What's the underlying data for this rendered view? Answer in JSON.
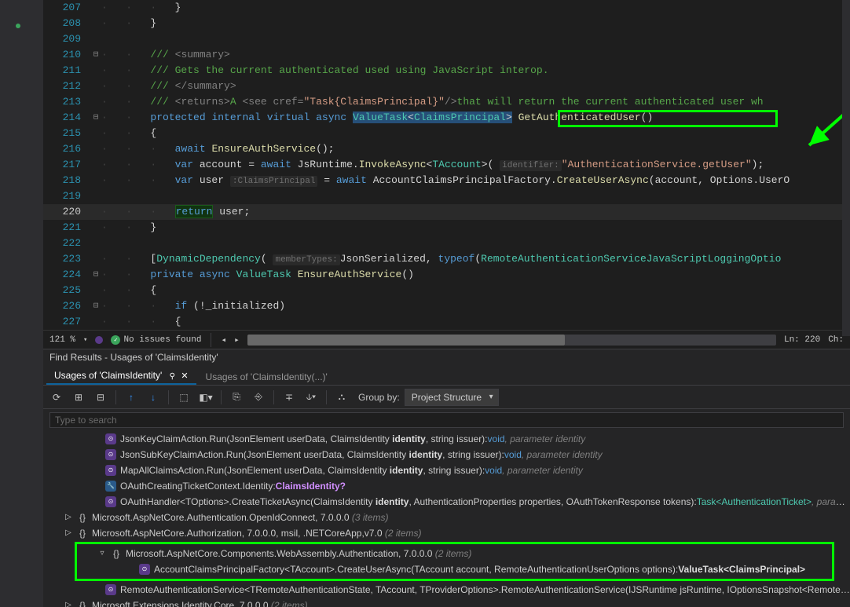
{
  "editor": {
    "zoom": "121 %",
    "no_issues": "No issues found",
    "line_pos": "Ln: 220",
    "char_pos": "Ch:",
    "lines": [
      {
        "n": "207",
        "fold": "",
        "code": "            }"
      },
      {
        "n": "208",
        "fold": "",
        "code": "        }"
      },
      {
        "n": "209",
        "fold": "",
        "code": ""
      },
      {
        "n": "210",
        "fold": "⊟",
        "code": "        /// <summary>"
      },
      {
        "n": "211",
        "fold": "",
        "code": "        /// Gets the current authenticated used using JavaScript interop."
      },
      {
        "n": "212",
        "fold": "",
        "code": "        /// </summary>"
      },
      {
        "n": "213",
        "fold": "",
        "code": "        /// <returns>A <see cref=\"Task{ClaimsPrincipal}\"/>that will return the current authenticated user wh"
      },
      {
        "n": "214",
        "fold": "⊟",
        "code": "        protected internal virtual async ValueTask<ClaimsPrincipal> GetAuthenticatedUser()"
      },
      {
        "n": "215",
        "fold": "",
        "code": "        {"
      },
      {
        "n": "216",
        "fold": "",
        "code": "            await EnsureAuthService();"
      },
      {
        "n": "217",
        "fold": "",
        "code": "            var account = await JsRuntime.InvokeAsync<TAccount>( identifier:\"AuthenticationService.getUser\");"
      },
      {
        "n": "218",
        "fold": "",
        "code": "            var user :ClaimsPrincipal = await AccountClaimsPrincipalFactory.CreateUserAsync(account, Options.UserO"
      },
      {
        "n": "219",
        "fold": "",
        "code": ""
      },
      {
        "n": "220",
        "fold": "",
        "code": "            return user;"
      },
      {
        "n": "221",
        "fold": "",
        "code": "        }"
      },
      {
        "n": "222",
        "fold": "",
        "code": ""
      },
      {
        "n": "223",
        "fold": "",
        "code": "        [DynamicDependency( memberTypes:JsonSerialized, typeof(RemoteAuthenticationServiceJavaScriptLoggingOptio"
      },
      {
        "n": "224",
        "fold": "⊟",
        "code": "        private async ValueTask EnsureAuthService()"
      },
      {
        "n": "225",
        "fold": "",
        "code": "        {"
      },
      {
        "n": "226",
        "fold": "⊟",
        "code": "            if (!_initialized)"
      },
      {
        "n": "227",
        "fold": "",
        "code": "            {"
      }
    ],
    "current_line": "220"
  },
  "find": {
    "title": "Find Results - Usages of 'ClaimsIdentity'",
    "tab1": "Usages of 'ClaimsIdentity'",
    "tab2": "Usages of 'ClaimsIdentity(...)'",
    "groupby_label": "Group by:",
    "groupby_value": "Project Structure",
    "search_placeholder": "Type to search",
    "rows": [
      {
        "indent": 3,
        "arrow": "",
        "icon": "method",
        "pre": "JsonKeyClaimAction.Run(JsonElement userData, ClaimsIdentity ",
        "b": "identity",
        "post": ", string issuer):",
        "rtype": "void",
        "tail": ", parameter identity"
      },
      {
        "indent": 3,
        "arrow": "",
        "icon": "method",
        "pre": "JsonSubKeyClaimAction.Run(JsonElement userData, ClaimsIdentity ",
        "b": "identity",
        "post": ", string issuer):",
        "rtype": "void",
        "tail": ", parameter identity"
      },
      {
        "indent": 3,
        "arrow": "",
        "icon": "method",
        "pre": "MapAllClaimsAction.Run(JsonElement userData, ClaimsIdentity ",
        "b": "identity",
        "post": ", string issuer):",
        "rtype": "void",
        "tail": ", parameter identity"
      },
      {
        "indent": 3,
        "arrow": "",
        "icon": "prop",
        "pre": "OAuthCreatingTicketContext.Identity:",
        "b": "",
        "post": "",
        "rtype": "",
        "tail": "",
        "typeq": "ClaimsIdentity?"
      },
      {
        "indent": 3,
        "arrow": "",
        "icon": "method",
        "pre": "OAuthHandler<TOptions>.CreateTicketAsync(ClaimsIdentity ",
        "b": "identity",
        "post": ", AuthenticationProperties properties, OAuthTokenResponse tokens):",
        "rtype": "",
        "tail": ", parameter identi",
        "ttype": "Task<AuthenticationTicket>"
      },
      {
        "indent": 1,
        "arrow": "▷",
        "icon": "ns",
        "pre": "Microsoft.AspNetCore.Authentication.OpenIdConnect, 7.0.0.0",
        "count": "  (3 items)"
      },
      {
        "indent": 1,
        "arrow": "▷",
        "icon": "ns",
        "pre": "Microsoft.AspNetCore.Authorization, 7.0.0.0, msil, .NETCoreApp,v7.0",
        "count": "  (2 items)"
      },
      {
        "indent": 1,
        "arrow": "▿",
        "icon": "ns",
        "pre": "Microsoft.AspNetCore.Components.WebAssembly.Authentication, 7.0.0.0",
        "count": "  (2 items)",
        "greenstart": true
      },
      {
        "indent": 3,
        "arrow": "",
        "icon": "method",
        "pre": "AccountClaimsPrincipalFactory<TAccount>.CreateUserAsync(TAccount account, RemoteAuthenticationUserOptions options):",
        "b": "ValueTask<ClaimsPrincipal>",
        "post": "",
        "rtype": "",
        "tail": "",
        "greenend": true
      },
      {
        "indent": 3,
        "arrow": "",
        "icon": "method",
        "pre": "RemoteAuthenticationService<TRemoteAuthenticationState, TAccount, TProviderOptions>.RemoteAuthenticationService(IJSRuntime jsRuntime, IOptionsSnapshot<RemoteAuthenticatio"
      },
      {
        "indent": 1,
        "arrow": "▷",
        "icon": "ns",
        "pre": "Microsoft.Extensions.Identity.Core, 7.0.0.0",
        "count": "  (2 items)"
      }
    ]
  }
}
